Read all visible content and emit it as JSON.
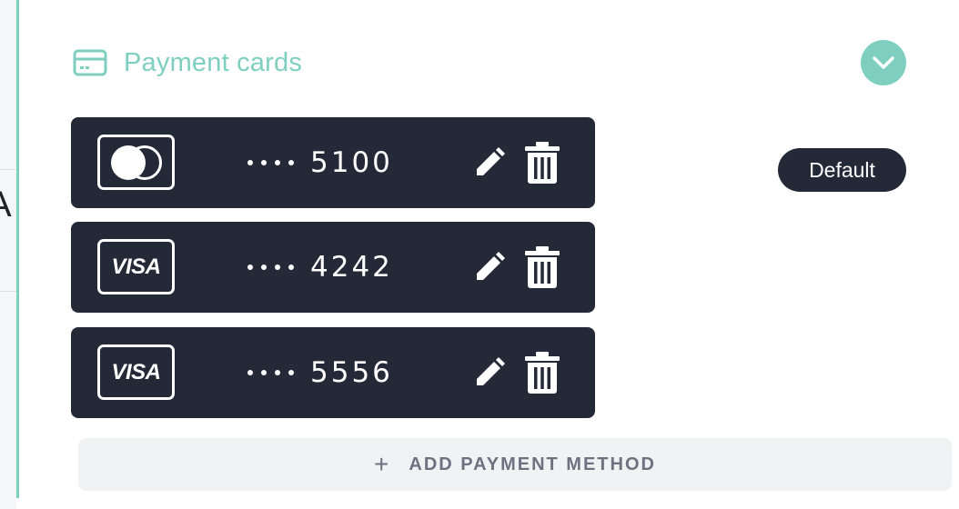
{
  "section": {
    "title": "Payment cards",
    "icon": "credit-card-icon",
    "accent_color": "#7fcfc1"
  },
  "collapse_toggle": {
    "icon": "chevron-down-icon"
  },
  "left_panel": {
    "clipped_text": "A"
  },
  "cards": [
    {
      "brand": "mastercard",
      "brand_icon": "mastercard-icon",
      "mask": "••••",
      "last4": "5100",
      "is_default": true
    },
    {
      "brand": "visa",
      "brand_label": "VISA",
      "brand_icon": "visa-icon",
      "mask": "••••",
      "last4": "4242",
      "is_default": false
    },
    {
      "brand": "visa",
      "brand_label": "VISA",
      "brand_icon": "visa-icon",
      "mask": "••••",
      "last4": "5556",
      "is_default": false
    }
  ],
  "default_badge": {
    "label": "Default"
  },
  "add_method": {
    "plus": "+",
    "label": "ADD PAYMENT METHOD"
  },
  "colors": {
    "card_bg": "#232937",
    "add_bg": "#f1f2f4",
    "add_text": "#6c7280"
  }
}
